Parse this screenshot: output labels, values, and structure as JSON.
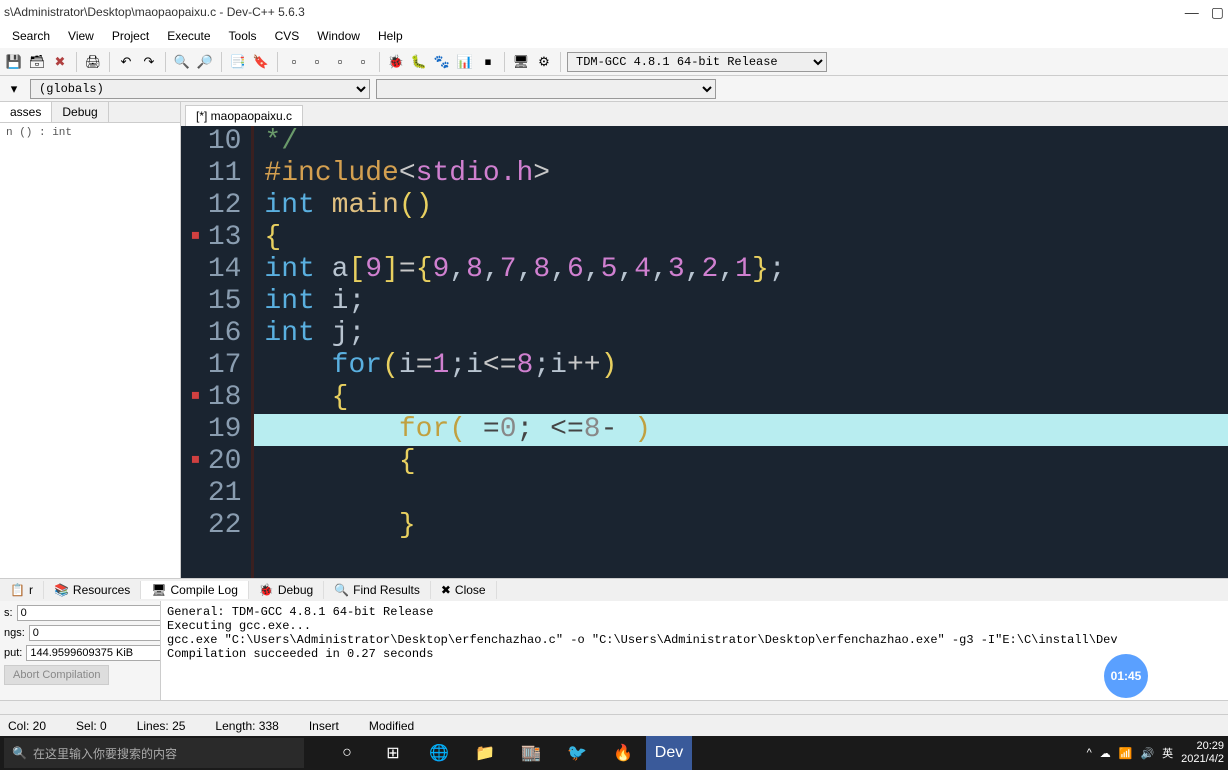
{
  "title": "s\\Administrator\\Desktop\\maopaopaixu.c - Dev-C++ 5.6.3",
  "menu": [
    "Search",
    "View",
    "Project",
    "Execute",
    "Tools",
    "CVS",
    "Window",
    "Help"
  ],
  "compiler_select": "TDM-GCC 4.8.1 64-bit Release",
  "scope_select": "(globals)",
  "side_tabs": [
    "asses",
    "Debug"
  ],
  "side_item": "n () : int",
  "file_tab": "[*] maopaopaixu.c",
  "code_lines": [
    {
      "n": "10",
      "marker": "",
      "html": "<span class='c-comment'>*/</span>"
    },
    {
      "n": "11",
      "marker": "",
      "html": "<span class='c-pp'>#include</span><span class='c-op'>&lt;</span><span class='c-str'>stdio.h</span><span class='c-op'>&gt;</span>"
    },
    {
      "n": "12",
      "marker": "",
      "html": "<span class='c-type'>int</span> <span class='c-fn'>main</span><span class='c-punct'>()</span>"
    },
    {
      "n": "13",
      "marker": "▪",
      "html": "<span class='c-punct'>{</span>"
    },
    {
      "n": "14",
      "marker": "",
      "html": "<span class='c-type'>int</span> a<span class='c-punct'>[</span><span class='c-num'>9</span><span class='c-punct'>]</span><span class='c-op'>=</span><span class='c-punct'>{</span><span class='c-num'>9</span>,<span class='c-num'>8</span>,<span class='c-num'>7</span>,<span class='c-num'>8</span>,<span class='c-num'>6</span>,<span class='c-num'>5</span>,<span class='c-num'>4</span>,<span class='c-num'>3</span>,<span class='c-num'>2</span>,<span class='c-num'>1</span><span class='c-punct'>}</span>;"
    },
    {
      "n": "15",
      "marker": "",
      "html": "<span class='c-type'>int</span> i;"
    },
    {
      "n": "16",
      "marker": "",
      "html": "<span class='c-type'>int</span> j;"
    },
    {
      "n": "17",
      "marker": "",
      "html": "    <span class='c-kw'>for</span><span class='c-punct'>(</span>i<span class='c-op'>=</span><span class='c-num'>1</span>;i<span class='c-op'>&lt;=</span><span class='c-num'>8</span>;i<span class='c-op'>++</span><span class='c-punct'>)</span>"
    },
    {
      "n": "18",
      "marker": "▪",
      "html": "    <span class='c-punct'>{</span>"
    },
    {
      "n": "19",
      "marker": "",
      "hl": true,
      "html": "        <span style='color:#c0a040'>for</span><span style='color:#c0a040'>(</span> <span style='color:#444'>=</span><span style='color:#888'>0</span><span style='color:#444'>;</span> <span style='color:#444'>&lt;=</span><span style='color:#888'>8</span><span style='color:#444'>-</span> <span style='color:#c0a040'>)</span>"
    },
    {
      "n": "20",
      "marker": "▪",
      "html": "        <span class='c-punct'>{</span>"
    },
    {
      "n": "21",
      "marker": "",
      "html": ""
    },
    {
      "n": "22",
      "marker": "",
      "html": "        <span class='c-punct'>}</span>"
    }
  ],
  "bottom_tabs": [
    {
      "icon": "📋",
      "label": "r"
    },
    {
      "icon": "📚",
      "label": "Resources"
    },
    {
      "icon": "🖥",
      "label": "Compile Log",
      "active": true
    },
    {
      "icon": "🐞",
      "label": "Debug"
    },
    {
      "icon": "🔍",
      "label": "Find Results"
    },
    {
      "icon": "✖",
      "label": "Close"
    }
  ],
  "stats": {
    "s_label": "s:",
    "s_val": "0",
    "ngs_label": "ngs:",
    "ngs_val": "0",
    "put_label": "put:",
    "put_val": "144.9599609375 KiB"
  },
  "abort": "Abort Compilation",
  "log": "General: TDM-GCC 4.8.1 64-bit Release\nExecuting gcc.exe...\ngcc.exe \"C:\\Users\\Administrator\\Desktop\\erfenchazhao.c\" -o \"C:\\Users\\Administrator\\Desktop\\erfenchazhao.exe\" -g3 -I\"E:\\C\\install\\Dev\nCompilation succeeded in 0.27 seconds",
  "status": {
    "col": "Col:  20",
    "sel": "Sel:  0",
    "lines": "Lines:  25",
    "length": "Length:  338",
    "insert": "Insert",
    "modified": "Modified"
  },
  "taskbar": {
    "search_placeholder": "在这里输入你要搜索的内容",
    "time": "20:29",
    "date": "2021/4/2",
    "lang": "英"
  },
  "badge": "01:45"
}
